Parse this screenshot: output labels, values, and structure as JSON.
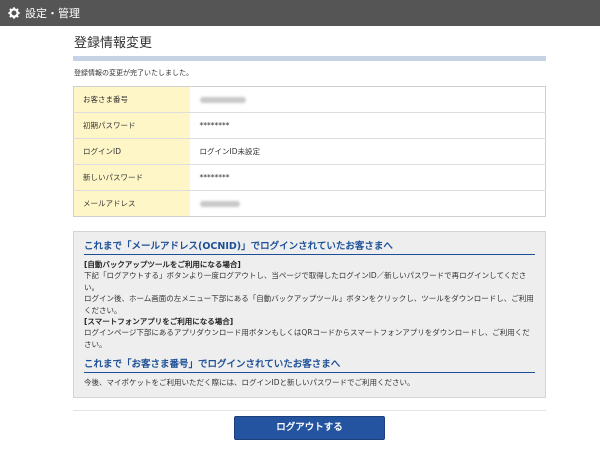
{
  "header": {
    "title": "設定・管理"
  },
  "page": {
    "title": "登録情報変更",
    "notice": "登録情報の変更が完了いたしました。"
  },
  "info_rows": [
    {
      "label": "お客さま番号",
      "value": ""
    },
    {
      "label": "初期パスワード",
      "value": "********"
    },
    {
      "label": "ログインID",
      "value": "ログインID未設定"
    },
    {
      "label": "新しいパスワード",
      "value": "********"
    },
    {
      "label": "メールアドレス",
      "value": ""
    }
  ],
  "help": {
    "heading1": "これまで「メールアドレス(OCNID)」でログインされていたお客さまへ",
    "sub1": "[自動バックアップツールをご利用になる場合]",
    "text1": "下記「ログアウトする」ボタンより一度ログアウトし、当ページで取得したログインID／新しいパスワードで再ログインしてください。",
    "text2": "ログイン後、ホーム画面の左メニュー下部にある「自動バックアップツール」ボタンをクリックし、ツールをダウンロードし、ご利用ください。",
    "sub2": "[スマートフォンアプリをご利用になる場合]",
    "text3": "ログインページ下部にあるアプリダウンロード用ボタンもしくはQRコードからスマートフォンアプリをダウンロードし、ご利用ください。",
    "heading2": "これまで「お客さま番号」でログインされていたお客さまへ",
    "text4": "今後、マイポケットをご利用いただく際には、ログインIDと新しいパスワードでご利用ください。"
  },
  "actions": {
    "logout_label": "ログアウトする"
  },
  "colors": {
    "topbar": "#555555",
    "accent": "#24549f",
    "label_bg": "#fff6c8",
    "link": "#1c4f96"
  }
}
